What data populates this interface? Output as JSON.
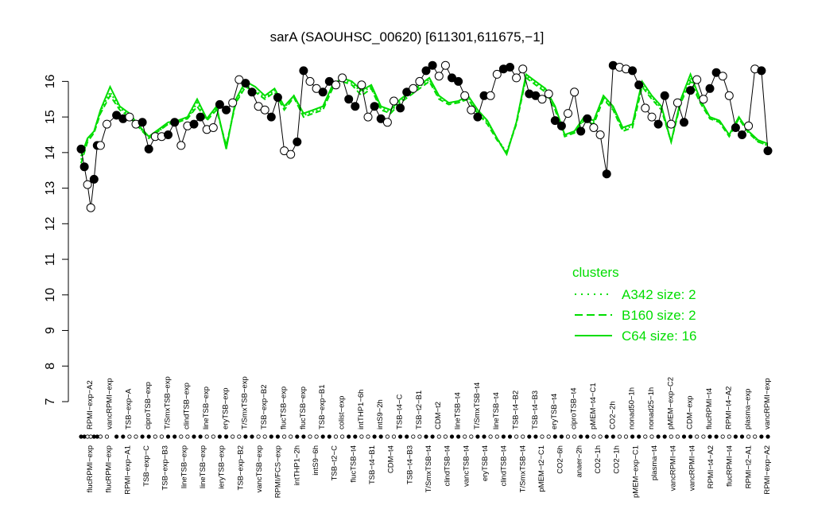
{
  "chart_data": {
    "type": "line",
    "title": "sarA (SAOUHSC_00620) [611301,611675,−1]",
    "xlabel": "",
    "ylabel": "",
    "ylim": [
      7,
      16.5
    ],
    "yticks": [
      7,
      8,
      9,
      10,
      11,
      12,
      13,
      14,
      15,
      16
    ],
    "grid": false,
    "legend": {
      "position": "right",
      "title": "clusters",
      "color": "#00dd00",
      "entries": [
        {
          "label": "A342 size: 2",
          "style": "dotted"
        },
        {
          "label": "B160 size: 2",
          "style": "dashed"
        },
        {
          "label": "C64 size: 16",
          "style": "solid"
        }
      ]
    },
    "top_labels": [
      "RPMI−exp−A2",
      "vancRPMI−exp",
      "TSB−exp−A",
      "ciproTSB−exp",
      "T/SmxTSB−exp",
      "clindTSB−exp",
      "lineTSB−exp",
      "eryTSB−exp",
      "T/SmxTSB−exp",
      "TSB−exp−B2",
      "flucTSB−exp",
      "flucTSB−exp",
      "TSB−exp−B1",
      "colist−exp",
      "intTHP1−6h",
      "intS9−2h",
      "TSB−t4−C",
      "TSB−t2−B1",
      "CDM−t2",
      "lineTSB−t4",
      "T/SmxTSB−t4",
      "lineTSB−t4",
      "TSB−t4−B2",
      "TSB−t4−B3",
      "eryTSB−t4",
      "ciproTSB−t4",
      "pMEM−t4−C1",
      "CO2−2h",
      "nonad50−1h",
      "nonad25−1h",
      "pMEM−exp−C2",
      "CDM−exp",
      "flucRPMI−t4",
      "RPMI−t4−A2",
      "plasma−exp",
      "vancRPMI−exp"
    ],
    "bottom_labels": [
      "flucRPMI−exp",
      "flucRPMI−exp",
      "RPMI−exp−A1",
      "TSB−exp−C",
      "TSB−exp−B3",
      "lineTSB−exp",
      "lineTSB−exp",
      "ieryTSB−exp",
      "TSB−exp−B2",
      "vancTSB−exp",
      "RPMI/FCS−exp",
      "intTHP1−2h",
      "intS9−6h",
      "TSB−t2−C",
      "flucTSB−t4",
      "TSB−t4−B1",
      "CDM−t4",
      "TSB−t4−B3",
      "T/SmxTSB−t4",
      "clindTSB−t4",
      "vancTSB−t4",
      "eryTSB−t4",
      "clindTSB−t4",
      "T/SmxTSB−t4",
      "pMEM−t2−C1",
      "CO2−6h",
      "anaer−2h",
      "CO2−1h",
      "CO2−1h",
      "pMEM−exp−C1",
      "plasma−t4",
      "vancRPMI−t4",
      "vancRPMI−t4",
      "RPMI−t4−A2",
      "flucRPMI−t4",
      "RPMI−t2−A1",
      "RPMI−exp−A2"
    ],
    "series": [
      {
        "name": "C64 size: 16",
        "style": "solid",
        "color": "#00dd00",
        "x": [
          1,
          3,
          5,
          7,
          10,
          13,
          16,
          19,
          22,
          25,
          28,
          31,
          34,
          37,
          40,
          43,
          46,
          49,
          52,
          55,
          58,
          61,
          64,
          67,
          70,
          73,
          76,
          79,
          82,
          85,
          88,
          91,
          94,
          97,
          100,
          103,
          106,
          109,
          112,
          115,
          118,
          121,
          124,
          127,
          130,
          133,
          136,
          139,
          142,
          145,
          148,
          151,
          154,
          157,
          160,
          163,
          166,
          169,
          172,
          175,
          178,
          181,
          184,
          187,
          190,
          193,
          196,
          199,
          202,
          205,
          208,
          211,
          214
        ],
        "values": [
          13.9,
          14.4,
          14.6,
          15.2,
          15.85,
          15.3,
          15.1,
          14.75,
          14.45,
          14.65,
          14.85,
          14.9,
          15.0,
          15.5,
          14.95,
          15.3,
          14.1,
          15.5,
          16.0,
          15.85,
          15.6,
          15.8,
          15.3,
          15.6,
          15.1,
          15.2,
          15.3,
          15.9,
          16.1,
          16.0,
          15.75,
          15.9,
          15.3,
          15.2,
          15.5,
          15.7,
          15.9,
          16.1,
          15.6,
          15.4,
          15.45,
          15.6,
          15.2,
          14.9,
          14.4,
          13.95,
          14.85,
          16.2,
          16.0,
          15.8,
          15.3,
          14.5,
          14.6,
          15.0,
          14.9,
          15.6,
          15.3,
          14.7,
          14.8,
          16.0,
          15.6,
          15.3,
          14.3,
          15.5,
          16.2,
          15.5,
          15.0,
          14.9,
          14.5,
          15.0,
          14.6,
          14.35,
          14.25
        ]
      },
      {
        "name": "B160 size: 2",
        "style": "dashed",
        "color": "#00dd00",
        "x": [
          1,
          3,
          5,
          7,
          10,
          13,
          16,
          19,
          22,
          25,
          28,
          31,
          34,
          37,
          40,
          43,
          46,
          49,
          52,
          55,
          58,
          61,
          64,
          67,
          70,
          73,
          76,
          79,
          82,
          85,
          88,
          91,
          94,
          97,
          100,
          103,
          106,
          109,
          112,
          115,
          118,
          121,
          124,
          127,
          130,
          133,
          136,
          139,
          142,
          145,
          148,
          151,
          154,
          157,
          160,
          163,
          166,
          169,
          172,
          175,
          178,
          181,
          184,
          187,
          190,
          193,
          196,
          199,
          202,
          205,
          208,
          211,
          214
        ],
        "values": [
          13.7,
          14.3,
          14.55,
          15.1,
          15.6,
          15.2,
          15.0,
          14.7,
          14.4,
          14.6,
          14.8,
          14.85,
          14.95,
          15.3,
          14.9,
          15.2,
          14.2,
          15.4,
          15.85,
          15.7,
          15.5,
          15.7,
          15.2,
          15.55,
          15.0,
          15.1,
          15.2,
          15.8,
          16.0,
          15.9,
          15.6,
          15.8,
          15.2,
          15.1,
          15.4,
          15.6,
          15.8,
          16.0,
          15.5,
          15.35,
          15.4,
          15.5,
          15.1,
          14.8,
          14.35,
          14.0,
          14.8,
          16.1,
          15.9,
          15.7,
          15.2,
          14.45,
          14.55,
          14.9,
          14.8,
          15.5,
          15.2,
          14.6,
          14.7,
          15.85,
          15.5,
          15.2,
          14.3,
          15.4,
          16.0,
          15.4,
          14.95,
          14.85,
          14.45,
          14.95,
          14.55,
          14.3,
          14.2
        ]
      },
      {
        "name": "A342 size: 2",
        "style": "dotted",
        "color": "#00dd00",
        "x": [
          1,
          3,
          5,
          7,
          10,
          13,
          16,
          19,
          22,
          25,
          28,
          31,
          34,
          37,
          40,
          43,
          46,
          49,
          52,
          55,
          58,
          61,
          64,
          67,
          70,
          73,
          76,
          79,
          82,
          85,
          88,
          91,
          94,
          97,
          100,
          103,
          106,
          109,
          112,
          115,
          118,
          121,
          124,
          127,
          130,
          133,
          136,
          139,
          142,
          145,
          148,
          151,
          154,
          157,
          160,
          163,
          166,
          169,
          172,
          175,
          178,
          181,
          184,
          187,
          190,
          193,
          196,
          199,
          202,
          205,
          208,
          211,
          214
        ],
        "values": [
          13.8,
          14.35,
          14.55,
          15.15,
          15.7,
          15.25,
          15.05,
          14.7,
          14.45,
          14.6,
          14.8,
          14.9,
          14.95,
          15.4,
          14.95,
          15.25,
          14.15,
          15.45,
          15.9,
          15.75,
          15.55,
          15.75,
          15.25,
          15.6,
          15.05,
          15.15,
          15.25,
          15.85,
          16.05,
          15.95,
          15.7,
          15.85,
          15.25,
          15.15,
          15.45,
          15.65,
          15.85,
          16.05,
          15.55,
          15.4,
          15.4,
          15.55,
          15.15,
          14.85,
          14.4,
          14.0,
          14.85,
          16.15,
          15.95,
          15.75,
          15.25,
          14.5,
          14.55,
          14.95,
          14.85,
          15.55,
          15.25,
          14.65,
          14.75,
          15.9,
          15.55,
          15.25,
          14.3,
          15.45,
          16.1,
          15.45,
          15.0,
          14.85,
          14.5,
          14.95,
          14.6,
          14.3,
          14.2
        ]
      },
      {
        "name": "",
        "style": "points",
        "color": "#000000",
        "x": [
          1,
          2,
          3,
          4,
          5,
          6,
          7,
          9,
          12,
          14,
          16,
          18,
          20,
          22,
          24,
          26,
          28,
          30,
          32,
          34,
          36,
          38,
          40,
          42,
          44,
          46,
          48,
          50,
          52,
          54,
          56,
          58,
          60,
          62,
          64,
          66,
          68,
          70,
          72,
          74,
          76,
          78,
          80,
          82,
          84,
          86,
          88,
          90,
          92,
          94,
          96,
          98,
          100,
          102,
          104,
          106,
          108,
          110,
          112,
          114,
          116,
          118,
          120,
          122,
          124,
          126,
          128,
          130,
          132,
          134,
          136,
          138,
          140,
          142,
          144,
          146,
          148,
          150,
          152,
          154,
          156,
          158,
          160,
          162,
          164,
          166,
          168,
          170,
          172,
          174,
          176,
          178,
          180,
          182,
          184,
          186,
          188,
          190,
          192,
          194,
          196,
          198,
          200,
          202,
          204,
          206,
          208,
          210,
          212,
          214
        ],
        "values": [
          14.1,
          13.6,
          13.1,
          12.45,
          13.25,
          14.2,
          14.2,
          14.8,
          15.05,
          14.95,
          15.0,
          14.8,
          14.85,
          14.1,
          14.45,
          14.45,
          14.5,
          14.85,
          14.2,
          14.75,
          14.8,
          15.0,
          14.65,
          14.7,
          15.35,
          15.2,
          15.4,
          16.05,
          15.95,
          15.7,
          15.3,
          15.2,
          15.0,
          15.55,
          14.05,
          13.95,
          14.3,
          16.3,
          16.0,
          15.8,
          15.7,
          16.0,
          15.9,
          16.1,
          15.5,
          15.3,
          15.9,
          15.0,
          15.3,
          14.95,
          14.85,
          15.45,
          15.25,
          15.7,
          15.8,
          16.0,
          16.3,
          16.45,
          16.15,
          16.45,
          16.1,
          16.0,
          15.6,
          15.2,
          15.0,
          15.6,
          15.6,
          16.2,
          16.35,
          16.4,
          16.1,
          16.35,
          15.65,
          15.6,
          15.5,
          15.65,
          14.9,
          14.75,
          15.1,
          15.7,
          14.6,
          14.95,
          14.7,
          14.5,
          13.4,
          16.45,
          16.4,
          16.35,
          16.3,
          15.9,
          15.25,
          15.0,
          14.8,
          15.6,
          14.8,
          15.4,
          14.85,
          15.75,
          16.05,
          15.5,
          15.8,
          16.25,
          16.15,
          15.6,
          14.7,
          14.5,
          14.75,
          16.35,
          16.3,
          14.05
        ]
      }
    ]
  }
}
